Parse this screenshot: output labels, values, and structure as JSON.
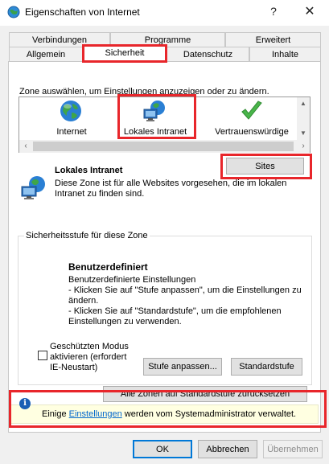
{
  "window": {
    "title": "Eigenschaften von Internet",
    "help_glyph": "?",
    "close_glyph": "✕"
  },
  "tabs": {
    "row1": [
      "Verbindungen",
      "Programme",
      "Erweitert"
    ],
    "row2": [
      "Allgemein",
      "Sicherheit",
      "Datenschutz",
      "Inhalte"
    ],
    "active": "Sicherheit"
  },
  "security": {
    "zone_hint": "Zone auswählen, um Einstellungen anzuzeigen oder zu ändern.",
    "zones": [
      {
        "label": "Internet",
        "icon": "globe-icon"
      },
      {
        "label": "Lokales Intranet",
        "icon": "intranet-icon"
      },
      {
        "label": "Vertrauenswürdige",
        "icon": "checkmark-icon"
      }
    ],
    "selected_zone": {
      "title": "Lokales Intranet",
      "description": "Diese Zone ist für alle Websites vorgesehen, die im lokalen Intranet zu finden sind.",
      "sites_button": "Sites"
    },
    "level_group": {
      "title": "Sicherheitsstufe für diese Zone",
      "custom_title": "Benutzerdefiniert",
      "custom_lines": [
        "Benutzerdefinierte Einstellungen",
        "- Klicken Sie auf \"Stufe anpassen\", um die Einstellungen zu ändern.",
        "- Klicken Sie auf \"Standardstufe\", um die empfohlenen Einstellungen zu verwenden."
      ],
      "protected_mode_label": "Geschützten Modus aktivieren (erfordert IE-Neustart)",
      "protected_mode_checked": false,
      "custom_level_button": "Stufe anpassen...",
      "default_level_button": "Standardstufe"
    },
    "reset_all_button": "Alle Zonen auf Standardstufe zurücksetzen",
    "admin_notice": {
      "prefix": "Einige ",
      "link": "Einstellungen",
      "suffix": " werden vom Systemadministrator verwaltet."
    }
  },
  "footer": {
    "ok": "OK",
    "cancel": "Abbrechen",
    "apply": "Übernehmen",
    "apply_enabled": false
  },
  "colors": {
    "highlight": "#e8262b",
    "link": "#0066cc",
    "info_bg": "#ffffe1",
    "accent": "#0078d7"
  }
}
